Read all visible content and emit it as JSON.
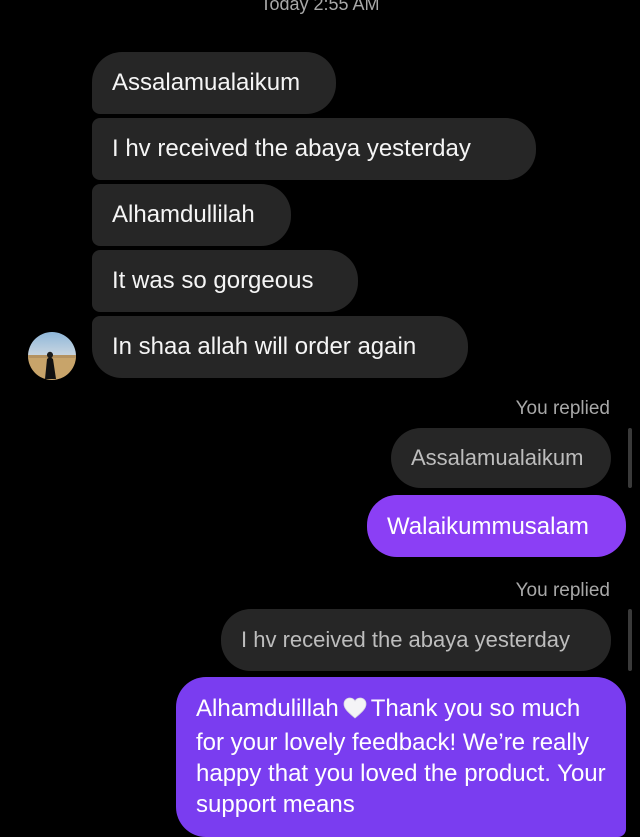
{
  "thread": {
    "timestamp": "Today 2:55 AM",
    "incoming": [
      "Assalamualaikum",
      "I hv received the abaya yesterday",
      "Alhamdullilah",
      "It was so gorgeous",
      "In shaa allah will order again"
    ],
    "avatar_icon": "user-avatar",
    "replies": [
      {
        "label": "You replied",
        "quoted": "Assalamualaikum",
        "message": "Walaikummusalam"
      },
      {
        "label": "You replied",
        "quoted": "I hv received the abaya yesterday",
        "message_part1": "Alhamdulillah",
        "message_emoji": "white-heart-icon",
        "message_part2": "Thank you so much for your lovely feedback! We’re really happy that you loved the product. Your support means"
      }
    ]
  },
  "colors": {
    "background": "#000000",
    "incoming_bubble": "#262626",
    "outgoing_bubble": "#8b3ff5",
    "secondary_text": "#a8a8a8"
  }
}
